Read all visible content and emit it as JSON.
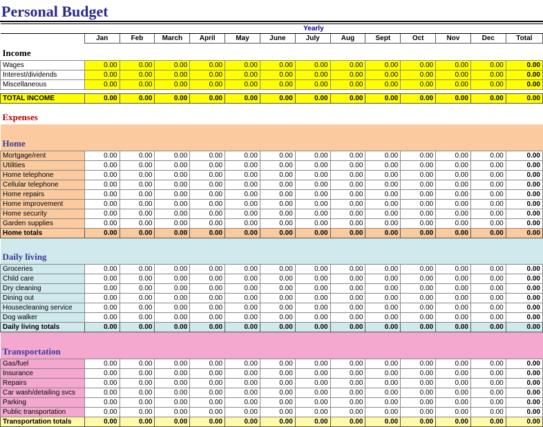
{
  "title": "Personal Budget",
  "period": "Yearly",
  "months": [
    "Jan",
    "Feb",
    "March",
    "April",
    "May",
    "June",
    "July",
    "Aug",
    "Sept",
    "Oct",
    "Nov",
    "Dec"
  ],
  "total_label": "Total",
  "income": {
    "title": "Income",
    "rows": [
      {
        "label": "Wages",
        "v": [
          "0.00",
          "0.00",
          "0.00",
          "0.00",
          "0.00",
          "0.00",
          "0.00",
          "0.00",
          "0.00",
          "0.00",
          "0.00",
          "0.00"
        ],
        "t": "0.00"
      },
      {
        "label": "Interest/dividends",
        "v": [
          "0.00",
          "0.00",
          "0.00",
          "0.00",
          "0.00",
          "0.00",
          "0.00",
          "0.00",
          "0.00",
          "0.00",
          "0.00",
          "0.00"
        ],
        "t": "0.00"
      },
      {
        "label": "Miscellaneous",
        "v": [
          "0.00",
          "0.00",
          "0.00",
          "0.00",
          "0.00",
          "0.00",
          "0.00",
          "0.00",
          "0.00",
          "0.00",
          "0.00",
          "0.00"
        ],
        "t": "0.00"
      }
    ],
    "total_label": "TOTAL INCOME",
    "total": {
      "v": [
        "0.00",
        "0.00",
        "0.00",
        "0.00",
        "0.00",
        "0.00",
        "0.00",
        "0.00",
        "0.00",
        "0.00",
        "0.00",
        "0.00"
      ],
      "t": "0.00"
    }
  },
  "expenses_title": "Expenses",
  "categories": [
    {
      "name": "Home",
      "bg": "bg-orange",
      "rows": [
        {
          "label": "Mortgage/rent",
          "v": [
            "0.00",
            "0.00",
            "0.00",
            "0.00",
            "0.00",
            "0.00",
            "0.00",
            "0.00",
            "0.00",
            "0.00",
            "0.00",
            "0.00"
          ],
          "t": "0.00"
        },
        {
          "label": "Utilities",
          "v": [
            "0.00",
            "0.00",
            "0.00",
            "0.00",
            "0.00",
            "0.00",
            "0.00",
            "0.00",
            "0.00",
            "0.00",
            "0.00",
            "0.00"
          ],
          "t": "0.00"
        },
        {
          "label": "Home telephone",
          "v": [
            "0.00",
            "0.00",
            "0.00",
            "0.00",
            "0.00",
            "0.00",
            "0.00",
            "0.00",
            "0.00",
            "0.00",
            "0.00",
            "0.00"
          ],
          "t": "0.00"
        },
        {
          "label": "Cellular telephone",
          "v": [
            "0.00",
            "0.00",
            "0.00",
            "0.00",
            "0.00",
            "0.00",
            "0.00",
            "0.00",
            "0.00",
            "0.00",
            "0.00",
            "0.00"
          ],
          "t": "0.00"
        },
        {
          "label": "Home repairs",
          "v": [
            "0.00",
            "0.00",
            "0.00",
            "0.00",
            "0.00",
            "0.00",
            "0.00",
            "0.00",
            "0.00",
            "0.00",
            "0.00",
            "0.00"
          ],
          "t": "0.00"
        },
        {
          "label": "Home improvement",
          "v": [
            "0.00",
            "0.00",
            "0.00",
            "0.00",
            "0.00",
            "0.00",
            "0.00",
            "0.00",
            "0.00",
            "0.00",
            "0.00",
            "0.00"
          ],
          "t": "0.00"
        },
        {
          "label": "Home security",
          "v": [
            "0.00",
            "0.00",
            "0.00",
            "0.00",
            "0.00",
            "0.00",
            "0.00",
            "0.00",
            "0.00",
            "0.00",
            "0.00",
            "0.00"
          ],
          "t": "0.00"
        },
        {
          "label": "Garden supplies",
          "v": [
            "0.00",
            "0.00",
            "0.00",
            "0.00",
            "0.00",
            "0.00",
            "0.00",
            "0.00",
            "0.00",
            "0.00",
            "0.00",
            "0.00"
          ],
          "t": "0.00"
        }
      ],
      "total_label": "Home totals",
      "total": {
        "v": [
          "0.00",
          "0.00",
          "0.00",
          "0.00",
          "0.00",
          "0.00",
          "0.00",
          "0.00",
          "0.00",
          "0.00",
          "0.00",
          "0.00"
        ],
        "t": "0.00"
      }
    },
    {
      "name": "Daily living",
      "bg": "bg-cyan",
      "rows": [
        {
          "label": "Groceries",
          "v": [
            "0.00",
            "0.00",
            "0.00",
            "0.00",
            "0.00",
            "0.00",
            "0.00",
            "0.00",
            "0.00",
            "0.00",
            "0.00",
            "0.00"
          ],
          "t": "0.00"
        },
        {
          "label": "Child care",
          "v": [
            "0.00",
            "0.00",
            "0.00",
            "0.00",
            "0.00",
            "0.00",
            "0.00",
            "0.00",
            "0.00",
            "0.00",
            "0.00",
            "0.00"
          ],
          "t": "0.00"
        },
        {
          "label": "Dry cleaning",
          "v": [
            "0.00",
            "0.00",
            "0.00",
            "0.00",
            "0.00",
            "0.00",
            "0.00",
            "0.00",
            "0.00",
            "0.00",
            "0.00",
            "0.00"
          ],
          "t": "0.00"
        },
        {
          "label": "Dining out",
          "v": [
            "0.00",
            "0.00",
            "0.00",
            "0.00",
            "0.00",
            "0.00",
            "0.00",
            "0.00",
            "0.00",
            "0.00",
            "0.00",
            "0.00"
          ],
          "t": "0.00"
        },
        {
          "label": "Housecleaning service",
          "v": [
            "0.00",
            "0.00",
            "0.00",
            "0.00",
            "0.00",
            "0.00",
            "0.00",
            "0.00",
            "0.00",
            "0.00",
            "0.00",
            "0.00"
          ],
          "t": "0.00"
        },
        {
          "label": "Dog walker",
          "v": [
            "0.00",
            "0.00",
            "0.00",
            "0.00",
            "0.00",
            "0.00",
            "0.00",
            "0.00",
            "0.00",
            "0.00",
            "0.00",
            "0.00"
          ],
          "t": "0.00"
        }
      ],
      "total_label": "Daily living totals",
      "total": {
        "v": [
          "0.00",
          "0.00",
          "0.00",
          "0.00",
          "0.00",
          "0.00",
          "0.00",
          "0.00",
          "0.00",
          "0.00",
          "0.00",
          "0.00"
        ],
        "t": "0.00"
      }
    },
    {
      "name": "Transportation",
      "bg": "bg-pink",
      "rows": [
        {
          "label": "Gas/fuel",
          "v": [
            "0.00",
            "0.00",
            "0.00",
            "0.00",
            "0.00",
            "0.00",
            "0.00",
            "0.00",
            "0.00",
            "0.00",
            "0.00",
            "0.00"
          ],
          "t": "0.00"
        },
        {
          "label": "Insurance",
          "v": [
            "0.00",
            "0.00",
            "0.00",
            "0.00",
            "0.00",
            "0.00",
            "0.00",
            "0.00",
            "0.00",
            "0.00",
            "0.00",
            "0.00"
          ],
          "t": "0.00"
        },
        {
          "label": "Repairs",
          "v": [
            "0.00",
            "0.00",
            "0.00",
            "0.00",
            "0.00",
            "0.00",
            "0.00",
            "0.00",
            "0.00",
            "0.00",
            "0.00",
            "0.00"
          ],
          "t": "0.00"
        },
        {
          "label": "Car wash/detailing svcs",
          "v": [
            "0.00",
            "0.00",
            "0.00",
            "0.00",
            "0.00",
            "0.00",
            "0.00",
            "0.00",
            "0.00",
            "0.00",
            "0.00",
            "0.00"
          ],
          "t": "0.00"
        },
        {
          "label": "Parking",
          "v": [
            "0.00",
            "0.00",
            "0.00",
            "0.00",
            "0.00",
            "0.00",
            "0.00",
            "0.00",
            "0.00",
            "0.00",
            "0.00",
            "0.00"
          ],
          "t": "0.00"
        },
        {
          "label": "Public transportation",
          "v": [
            "0.00",
            "0.00",
            "0.00",
            "0.00",
            "0.00",
            "0.00",
            "0.00",
            "0.00",
            "0.00",
            "0.00",
            "0.00",
            "0.00"
          ],
          "t": "0.00"
        }
      ],
      "total_label": "Transportation totals",
      "total_bg": "bg-ltyellow",
      "total": {
        "v": [
          "0.00",
          "0.00",
          "0.00",
          "0.00",
          "0.00",
          "0.00",
          "0.00",
          "0.00",
          "0.00",
          "0.00",
          "0.00",
          "0.00"
        ],
        "t": "0.00"
      }
    }
  ]
}
